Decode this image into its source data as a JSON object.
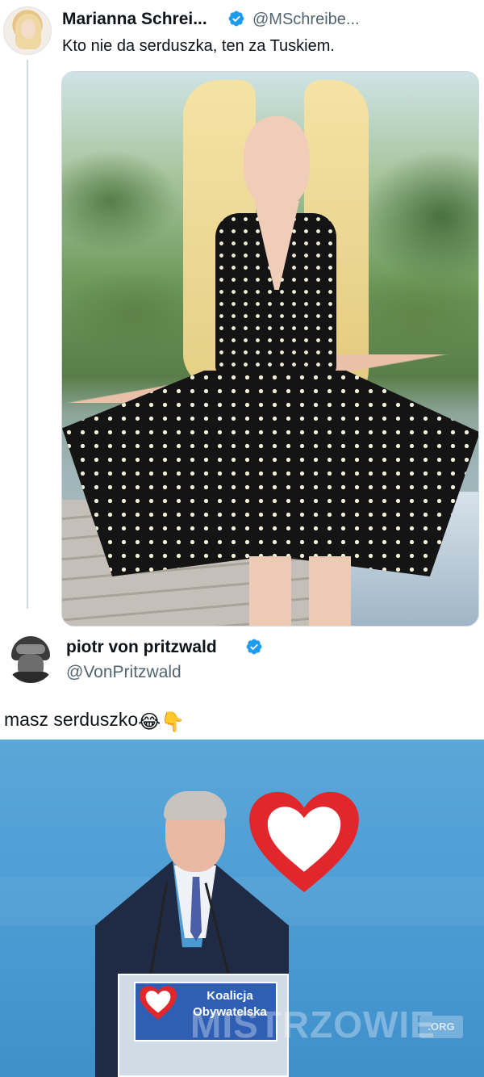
{
  "original_post": {
    "author_name": "Marianna Schrei...",
    "author_handle": "@MSchreibe...",
    "text": "Kto nie da serduszka, ten za Tuskiem.",
    "verified": true
  },
  "reply": {
    "author_name": "piotr von pritzwald",
    "author_handle": "@VonPritzwald",
    "text": "masz serduszko",
    "emojis": [
      "😂",
      "👇"
    ],
    "verified": true
  },
  "reply_image": {
    "podium_sign_line1": "Koalicja",
    "podium_sign_line2": "Obywatelska",
    "watermark": "MISTRZOWIE",
    "watermark_suffix": ".ORG"
  },
  "colors": {
    "verified_blue": "#1d9bf0",
    "handle_gray": "#536471",
    "heart_red": "#e1262c",
    "stage_blue": "#4b9bd3"
  },
  "icons": {
    "verified": "verified-badge-icon"
  }
}
